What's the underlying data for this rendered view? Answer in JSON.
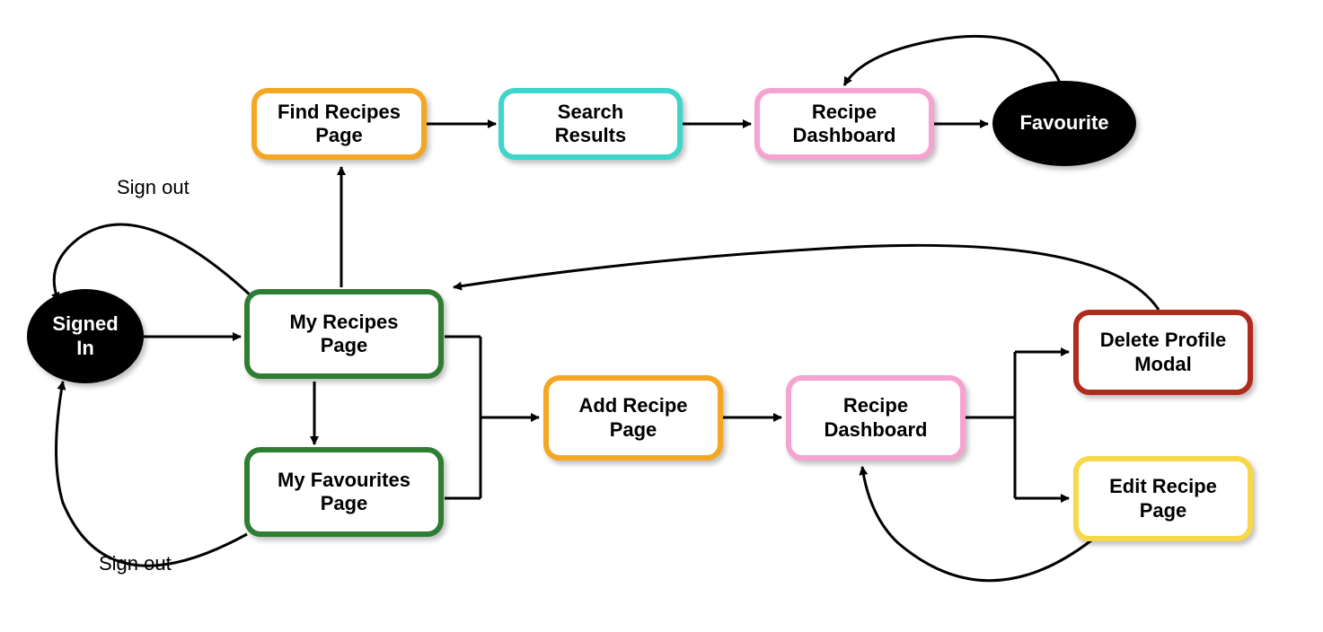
{
  "nodes": {
    "signedIn": {
      "label": "Signed\nIn"
    },
    "findRecipes": {
      "label": "Find Recipes\nPage"
    },
    "searchResults": {
      "label": "Search Results"
    },
    "recipeDashboard1": {
      "label": "Recipe\nDashboard"
    },
    "favourite": {
      "label": "Favourite"
    },
    "myRecipes": {
      "label": "My Recipes\nPage"
    },
    "myFavourites": {
      "label": "My Favourites\nPage"
    },
    "addRecipe": {
      "label": "Add Recipe\nPage"
    },
    "recipeDashboard2": {
      "label": "Recipe\nDashboard"
    },
    "deleteProfile": {
      "label": "Delete Profile\nModal"
    },
    "editRecipe": {
      "label": "Edit Recipe\nPage"
    }
  },
  "labels": {
    "signOut1": "Sign out",
    "signOut2": "Sign out"
  },
  "colors": {
    "orange": "#F5A623",
    "teal": "#3ED5CB",
    "pink": "#F5A3D0",
    "green": "#2E7D32",
    "darkRed": "#B02A1E",
    "yellow": "#F7D84B",
    "black": "#000000"
  }
}
